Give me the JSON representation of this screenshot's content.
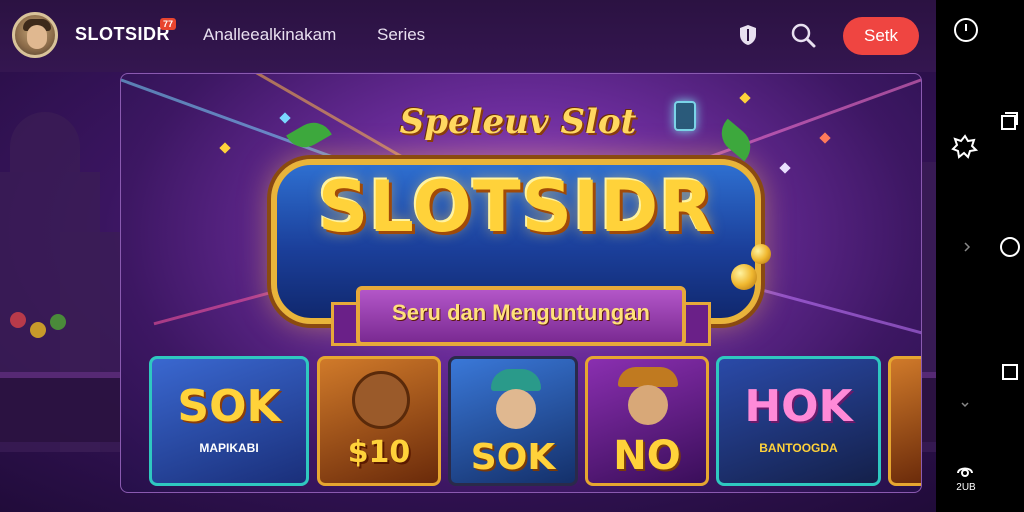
{
  "header": {
    "brand": "SLOTSIDR",
    "brand_badge": "77",
    "nav": [
      "Analleealkinakam",
      "Series"
    ],
    "cta_label": "Setk",
    "icons": [
      "shield-icon",
      "search-icon"
    ]
  },
  "banner": {
    "tagline_top": "Speleuv Slot",
    "title": "SLOTSIDR",
    "subtitle": "Seru dan Menguntungan"
  },
  "tiles": [
    {
      "title": "SOK",
      "sub": "MAPIKABI",
      "border": "#2fc8c0",
      "bg": "#2a4aa8"
    },
    {
      "title": "$10",
      "sub": "",
      "border": "#e6a630",
      "bg": "#a0521a"
    },
    {
      "title": "SOK",
      "sub": "",
      "border": "#2a2a4a",
      "bg": "#1f3f8a"
    },
    {
      "title": "NO",
      "sub": "",
      "border": "#e6a630",
      "bg": "#6a1f8a"
    },
    {
      "title": "HOK",
      "sub": "BANTOOGDA",
      "border": "#2fc8c0",
      "bg": "#1c2a7a"
    }
  ],
  "system_bar": {
    "caption": "2UB",
    "icons": [
      "power-icon",
      "recent-apps-icon",
      "settings-gear-icon",
      "chevron-right-icon",
      "home-circle-icon",
      "back-square-icon",
      "chevron-down-icon",
      "accessibility-icon"
    ]
  },
  "colors": {
    "cta": "#ef4541",
    "topbar": "#2b1242",
    "accent_gold": "#ffd23a"
  }
}
